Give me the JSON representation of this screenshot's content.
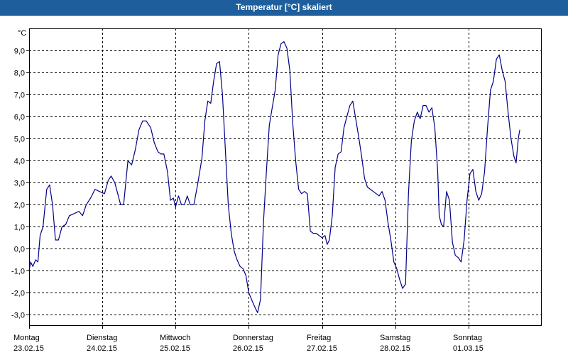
{
  "window": {
    "title": "Temperatur [°C] skaliert"
  },
  "chart_data": {
    "type": "line",
    "title": "Temperatur [°C] skaliert",
    "ylabel": "°C",
    "xlabel": "",
    "ylim": [
      -3.5,
      10.0
    ],
    "xlim": [
      0,
      7.0
    ],
    "y_ticks": [
      {
        "v": 9.0,
        "label": "9,0"
      },
      {
        "v": 8.0,
        "label": "8,0"
      },
      {
        "v": 7.0,
        "label": "7,0"
      },
      {
        "v": 6.0,
        "label": "6,0"
      },
      {
        "v": 5.0,
        "label": "5,0"
      },
      {
        "v": 4.0,
        "label": "4,0"
      },
      {
        "v": 3.0,
        "label": "3,0"
      },
      {
        "v": 2.0,
        "label": "2,0"
      },
      {
        "v": 1.0,
        "label": "1,0"
      },
      {
        "v": 0.0,
        "label": "0,0"
      },
      {
        "v": -1.0,
        "label": "-1,0"
      },
      {
        "v": -2.0,
        "label": "-2,0"
      },
      {
        "v": -3.0,
        "label": "-3,0"
      }
    ],
    "x_ticks": [
      {
        "day": "Montag",
        "date": "23.02.15"
      },
      {
        "day": "Dienstag",
        "date": "24.02.15"
      },
      {
        "day": "Mittwoch",
        "date": "25.02.15"
      },
      {
        "day": "Donnerstag",
        "date": "26.02.15"
      },
      {
        "day": "Freitag",
        "date": "27.02.15"
      },
      {
        "day": "Samstag",
        "date": "28.02.15"
      },
      {
        "day": "Sonntag",
        "date": "01.03.15"
      }
    ],
    "grid": true,
    "series_color": "#00008b",
    "series": [
      {
        "values": [
          [
            0.0,
            -1.0
          ],
          [
            0.02,
            -0.6
          ],
          [
            0.05,
            -0.8
          ],
          [
            0.09,
            -0.5
          ],
          [
            0.12,
            -0.6
          ],
          [
            0.15,
            0.6
          ],
          [
            0.19,
            1.0
          ],
          [
            0.24,
            2.7
          ],
          [
            0.28,
            2.9
          ],
          [
            0.32,
            2.0
          ],
          [
            0.36,
            0.4
          ],
          [
            0.4,
            0.4
          ],
          [
            0.45,
            1.0
          ],
          [
            0.5,
            1.1
          ],
          [
            0.55,
            1.5
          ],
          [
            0.62,
            1.6
          ],
          [
            0.68,
            1.7
          ],
          [
            0.73,
            1.5
          ],
          [
            0.78,
            2.0
          ],
          [
            0.84,
            2.3
          ],
          [
            0.9,
            2.7
          ],
          [
            0.96,
            2.6
          ],
          [
            1.03,
            2.5
          ],
          [
            1.08,
            3.1
          ],
          [
            1.12,
            3.3
          ],
          [
            1.17,
            3.0
          ],
          [
            1.21,
            2.5
          ],
          [
            1.25,
            2.0
          ],
          [
            1.29,
            2.0
          ],
          [
            1.35,
            4.0
          ],
          [
            1.4,
            3.8
          ],
          [
            1.45,
            4.5
          ],
          [
            1.5,
            5.4
          ],
          [
            1.55,
            5.8
          ],
          [
            1.6,
            5.8
          ],
          [
            1.66,
            5.5
          ],
          [
            1.71,
            4.8
          ],
          [
            1.76,
            4.4
          ],
          [
            1.8,
            4.3
          ],
          [
            1.84,
            4.3
          ],
          [
            1.89,
            3.5
          ],
          [
            1.93,
            2.2
          ],
          [
            1.97,
            2.3
          ],
          [
            2.0,
            1.9
          ],
          [
            2.04,
            2.4
          ],
          [
            2.08,
            2.0
          ],
          [
            2.12,
            2.0
          ],
          [
            2.16,
            2.4
          ],
          [
            2.2,
            2.0
          ],
          [
            2.25,
            2.0
          ],
          [
            2.3,
            2.9
          ],
          [
            2.36,
            4.1
          ],
          [
            2.4,
            5.8
          ],
          [
            2.44,
            6.7
          ],
          [
            2.48,
            6.6
          ],
          [
            2.52,
            7.6
          ],
          [
            2.56,
            8.4
          ],
          [
            2.6,
            8.5
          ],
          [
            2.64,
            7.0
          ],
          [
            2.68,
            4.5
          ],
          [
            2.72,
            2.0
          ],
          [
            2.76,
            0.7
          ],
          [
            2.8,
            -0.1
          ],
          [
            2.84,
            -0.5
          ],
          [
            2.88,
            -0.8
          ],
          [
            2.92,
            -0.9
          ],
          [
            2.96,
            -1.2
          ],
          [
            3.0,
            -2.0
          ],
          [
            3.05,
            -2.4
          ],
          [
            3.09,
            -2.7
          ],
          [
            3.12,
            -2.9
          ],
          [
            3.16,
            -2.3
          ],
          [
            3.2,
            1.2
          ],
          [
            3.24,
            3.5
          ],
          [
            3.28,
            5.6
          ],
          [
            3.32,
            6.4
          ],
          [
            3.36,
            7.2
          ],
          [
            3.4,
            8.8
          ],
          [
            3.44,
            9.3
          ],
          [
            3.48,
            9.4
          ],
          [
            3.52,
            9.1
          ],
          [
            3.56,
            8.1
          ],
          [
            3.6,
            5.7
          ],
          [
            3.64,
            4.0
          ],
          [
            3.68,
            2.7
          ],
          [
            3.72,
            2.5
          ],
          [
            3.76,
            2.6
          ],
          [
            3.8,
            2.5
          ],
          [
            3.84,
            0.8
          ],
          [
            3.88,
            0.7
          ],
          [
            3.92,
            0.7
          ],
          [
            3.96,
            0.6
          ],
          [
            4.0,
            0.5
          ],
          [
            4.04,
            0.6
          ],
          [
            4.07,
            0.2
          ],
          [
            4.1,
            0.4
          ],
          [
            4.14,
            1.5
          ],
          [
            4.18,
            3.7
          ],
          [
            4.22,
            4.3
          ],
          [
            4.26,
            4.4
          ],
          [
            4.3,
            5.5
          ],
          [
            4.34,
            6.0
          ],
          [
            4.38,
            6.5
          ],
          [
            4.42,
            6.7
          ],
          [
            4.46,
            5.9
          ],
          [
            4.5,
            5.1
          ],
          [
            4.54,
            4.2
          ],
          [
            4.58,
            3.2
          ],
          [
            4.62,
            2.8
          ],
          [
            4.66,
            2.7
          ],
          [
            4.7,
            2.6
          ],
          [
            4.74,
            2.5
          ],
          [
            4.78,
            2.4
          ],
          [
            4.82,
            2.6
          ],
          [
            4.86,
            2.2
          ],
          [
            4.9,
            1.2
          ],
          [
            4.94,
            0.4
          ],
          [
            4.98,
            -0.6
          ],
          [
            5.02,
            -0.9
          ],
          [
            5.06,
            -1.4
          ],
          [
            5.1,
            -1.8
          ],
          [
            5.14,
            -1.6
          ],
          [
            5.18,
            2.5
          ],
          [
            5.22,
            4.9
          ],
          [
            5.26,
            5.8
          ],
          [
            5.3,
            6.2
          ],
          [
            5.34,
            5.9
          ],
          [
            5.38,
            6.5
          ],
          [
            5.42,
            6.5
          ],
          [
            5.46,
            6.2
          ],
          [
            5.5,
            6.4
          ],
          [
            5.54,
            5.5
          ],
          [
            5.58,
            3.5
          ],
          [
            5.6,
            1.5
          ],
          [
            5.63,
            1.1
          ],
          [
            5.66,
            1.0
          ],
          [
            5.7,
            2.6
          ],
          [
            5.74,
            2.2
          ],
          [
            5.78,
            0.3
          ],
          [
            5.82,
            -0.3
          ],
          [
            5.86,
            -0.4
          ],
          [
            5.9,
            -0.6
          ],
          [
            5.94,
            0.4
          ],
          [
            5.98,
            2.2
          ],
          [
            6.02,
            3.4
          ],
          [
            6.06,
            3.6
          ],
          [
            6.1,
            2.6
          ],
          [
            6.14,
            2.2
          ],
          [
            6.18,
            2.5
          ],
          [
            6.22,
            3.5
          ],
          [
            6.26,
            5.5
          ],
          [
            6.3,
            7.2
          ],
          [
            6.34,
            7.6
          ],
          [
            6.38,
            8.6
          ],
          [
            6.42,
            8.8
          ],
          [
            6.46,
            8.1
          ],
          [
            6.5,
            7.6
          ],
          [
            6.54,
            6.2
          ],
          [
            6.58,
            5.0
          ],
          [
            6.62,
            4.2
          ],
          [
            6.65,
            3.9
          ],
          [
            6.68,
            5.0
          ],
          [
            6.7,
            5.4
          ]
        ]
      }
    ]
  }
}
